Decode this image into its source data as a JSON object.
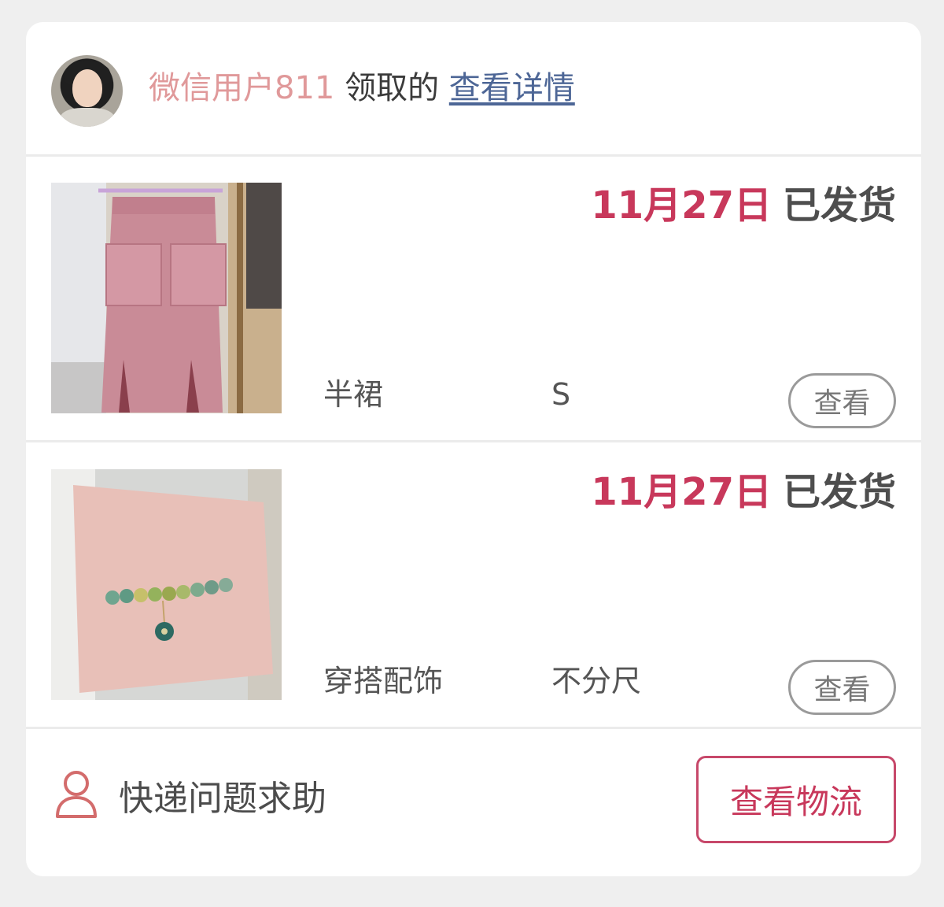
{
  "header": {
    "username": "微信用户811",
    "action": "领取的",
    "detail_link": "查看详情"
  },
  "items": [
    {
      "date": "11月27日",
      "status": "已发货",
      "name": "半裙",
      "size": "S",
      "view_label": "查看",
      "thumbnail": "pink-skirt-photo"
    },
    {
      "date": "11月27日",
      "status": "已发货",
      "name": "穿搭配饰",
      "size": "不分尺",
      "view_label": "查看",
      "thumbnail": "bracelet-photo"
    }
  ],
  "footer": {
    "help_label": "快递问题求助",
    "help_icon": "person-icon",
    "logistics_label": "查看物流"
  },
  "colors": {
    "accent": "#c8385b",
    "username": "#e0999a",
    "link": "#4d6696"
  }
}
